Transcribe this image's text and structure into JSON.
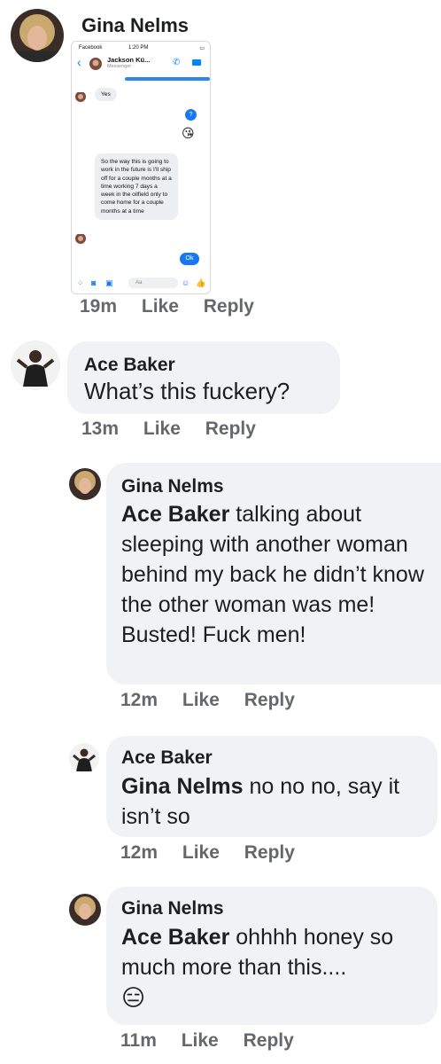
{
  "post": {
    "author": "Gina Nelms",
    "screenshot": {
      "status_left": "Facebook",
      "status_time": "1:20 PM",
      "contact_name": "Jackson Kü...",
      "contact_sub": "Messenger",
      "msg_yes": "Yes",
      "msg_question": "?",
      "msg_long": "So the way this is going to work in the future is I'll ship off for a couple months at a time working 7 days a week in the oilfield only to come home for a couple months at a time",
      "msg_ok": "Ok",
      "composer_placeholder": "Aa",
      "emoji_kiss": "😘"
    },
    "time": "19m",
    "like": "Like",
    "reply": "Reply"
  },
  "comments": [
    {
      "author": "Ace Baker",
      "mention": "",
      "text": "What’s this fuckery?",
      "time": "13m",
      "like": "Like",
      "reply": "Reply"
    },
    {
      "author": "Gina Nelms",
      "mention": "Ace Baker",
      "text": " talking about sleeping with another woman behind my back he didn’t know the other woman was me! Busted! Fuck men!",
      "time": "12m",
      "like": "Like",
      "reply": "Reply"
    },
    {
      "author": "Ace Baker",
      "mention": "Gina Nelms",
      "text": " no no no, say it isn’t so",
      "time": "12m",
      "like": "Like",
      "reply": "Reply"
    },
    {
      "author": "Gina Nelms",
      "mention": "Ace Baker",
      "text": " ohhhh honey so much more than this....",
      "emoji": "😑",
      "time": "11m",
      "like": "Like",
      "reply": "Reply"
    }
  ],
  "colors": {
    "bubble": "#f0f2f5",
    "meta": "#65676b",
    "messenger_blue": "#1877f2"
  }
}
